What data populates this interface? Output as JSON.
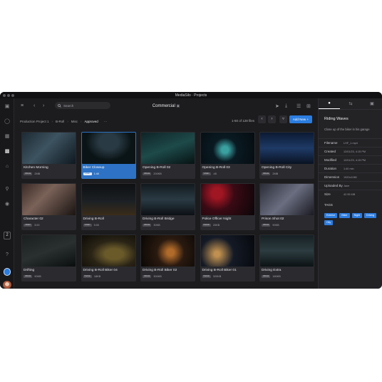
{
  "window": {
    "title": "MediaSilo · Projects"
  },
  "toolbar": {
    "search_label": "Search",
    "page_title": "Commercial",
    "icons": [
      "sidebar-toggle-icon",
      "back-icon",
      "forward-icon",
      "search-icon",
      "send-icon",
      "download-icon",
      "list-view-icon",
      "settings-icon"
    ]
  },
  "breadcrumb": [
    "Production Project 1",
    "B-Roll",
    "Misc",
    "Approved"
  ],
  "breadcrumb_more": "···",
  "pagination": {
    "label": "1-50 of 128 files"
  },
  "add_new_label": "Add New",
  "sidebar_nav": {
    "boxed_label": "2"
  },
  "assets": [
    {
      "name": "Kitchen Morning",
      "chip": "IMAGE",
      "meta": "2MB",
      "selected": false
    },
    {
      "name": "Biker Closeup",
      "chip": "VIDEO",
      "meta": "1:40",
      "selected": true
    },
    {
      "name": "Opening B-Roll 02",
      "chip": "IMAGE",
      "meta": "200KB",
      "selected": false
    },
    {
      "name": "Opening B-Roll 03",
      "chip": "VIDEO",
      "meta": ":45",
      "selected": false
    },
    {
      "name": "Opening B-Roll City",
      "chip": "IMAGE",
      "meta": "2MB",
      "selected": false
    },
    {
      "name": "Character 02",
      "chip": "VIDEO",
      "meta": "3:00",
      "selected": false
    },
    {
      "name": "Driving B-Roll",
      "chip": "VIDEO",
      "meta": "5:00",
      "selected": false
    },
    {
      "name": "Driving B-Roll Bridge",
      "chip": "IMAGE",
      "meta": "30KB",
      "selected": false
    },
    {
      "name": "Police Officer Night",
      "chip": "IMAGE",
      "meta": "20KB",
      "selected": false
    },
    {
      "name": "Prison Shot 02",
      "chip": "IMAGE",
      "meta": "90KB",
      "selected": false
    },
    {
      "name": "Drifting",
      "chip": "IMAGE",
      "meta": "90KB",
      "selected": false
    },
    {
      "name": "Driving B-Roll Biker 04",
      "chip": "IMAGE",
      "meta": "18KB",
      "selected": false
    },
    {
      "name": "Driving B-Roll Biker 02",
      "chip": "IMAGE",
      "meta": "300KB",
      "selected": false
    },
    {
      "name": "Driving B-Roll Biker 01",
      "chip": "IMAGE",
      "meta": "320KB",
      "selected": false
    },
    {
      "name": "Driving Extra",
      "chip": "IMAGE",
      "meta": "180KB",
      "selected": false
    }
  ],
  "details": {
    "title": "Riding Waves",
    "description": "Close up of the biker in his garage",
    "rows": [
      {
        "key": "Filename",
        "value": "LHF_1.mp4"
      },
      {
        "key": "Created",
        "value": "12/01/23, 4:15 PM"
      },
      {
        "key": "Modified",
        "value": "12/01/23, 4:15 PM"
      },
      {
        "key": "Duration",
        "value": "1:40 min"
      },
      {
        "key": "Dimension",
        "value": "1920x1080"
      },
      {
        "key": "Uploaded By",
        "value": "Jane"
      },
      {
        "key": "Size",
        "value": "42.95 MB"
      }
    ],
    "tags_header": "TAGS",
    "tags": [
      "Exterior",
      "Biker",
      "Night",
      "Driving",
      "City"
    ]
  },
  "colors": {
    "accent": "#2b7de0",
    "background": "#1c1c1e",
    "card": "#2b2b2f"
  }
}
